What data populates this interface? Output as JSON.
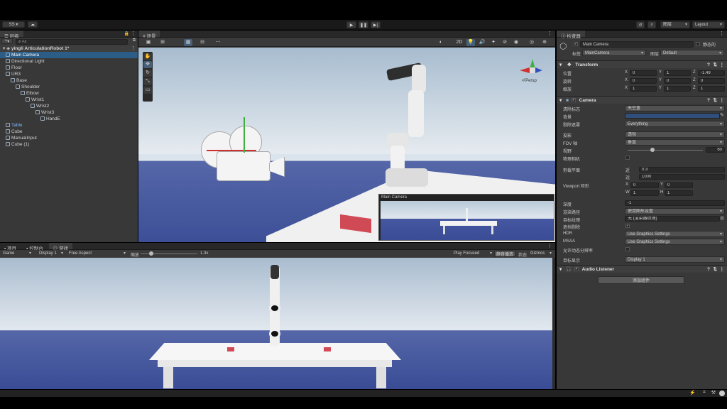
{
  "toolbar": {
    "account": "SS",
    "play_icon": "play-icon",
    "pause_icon": "pause-icon",
    "step_icon": "step-icon",
    "history_icon": "history-icon",
    "search_icon": "search-icon",
    "layers": "图层",
    "layout": "Layout"
  },
  "hierarchy": {
    "tab": "层级",
    "add": "+",
    "search_placeholder": "All",
    "scene": "yingli ArticulationRobot 1*",
    "items": [
      {
        "label": "Main Camera",
        "depth": 1,
        "selected": true
      },
      {
        "label": "Directional Light",
        "depth": 1
      },
      {
        "label": "Floor",
        "depth": 1
      },
      {
        "label": "UR3",
        "depth": 1
      },
      {
        "label": "Base",
        "depth": 2
      },
      {
        "label": "Shoulder",
        "depth": 3
      },
      {
        "label": "Elbow",
        "depth": 4
      },
      {
        "label": "Wrist1",
        "depth": 5
      },
      {
        "label": "Wrist2",
        "depth": 6
      },
      {
        "label": "Wrist3",
        "depth": 7
      },
      {
        "label": "HandE",
        "depth": 8
      },
      {
        "label": "Table",
        "depth": 1,
        "highlight": true
      },
      {
        "label": "Cube",
        "depth": 1
      },
      {
        "label": "ManualInput",
        "depth": 1
      },
      {
        "label": "Cube (1)",
        "depth": 1
      }
    ]
  },
  "scene": {
    "tab": "场景",
    "persp": "≮ Persp",
    "preview_title": "Main Camera"
  },
  "bottom": {
    "tabs": [
      "项目",
      "控制台",
      "游戏"
    ],
    "game": "Game",
    "display": "Display 1",
    "aspect": "Free Aspect",
    "scale_label": "缩放",
    "scale_value": "1.3x",
    "play_focused": "Play Focused",
    "mute": "静音播放",
    "stats": "状态",
    "gizmos": "Gizmos"
  },
  "inspector": {
    "tab": "检查器",
    "name": "Main Camera",
    "static": "静态的",
    "tag_label": "标签",
    "tag": "MainCamera",
    "layer_label": "图层",
    "layer": "Default",
    "transform": {
      "title": "Transform",
      "rows": [
        {
          "label": "位置",
          "x": "0",
          "y": "1",
          "z": "-1.49"
        },
        {
          "label": "旋转",
          "x": "0",
          "y": "0",
          "z": "0"
        },
        {
          "label": "缩放",
          "x": "1",
          "y": "1",
          "z": "1"
        }
      ]
    },
    "camera": {
      "title": "Camera",
      "clear_flags_label": "清除标志",
      "clear_flags": "天空盒",
      "background_label": "背景",
      "background_color": "#314d79",
      "culling_label": "剔除遮罩",
      "culling": "Everything",
      "projection_label": "投影",
      "projection": "透视",
      "fov_axis_label": "FOV 轴",
      "fov_axis": "垂直",
      "fov_label": "视野",
      "fov": "60",
      "fov_fraction": 0.33,
      "physical_label": "物理相机",
      "clip_label": "剪裁平面",
      "near_label": "近",
      "near": "0.3",
      "far_label": "远",
      "far": "1000",
      "viewport_label": "Viewport 矩形",
      "vx": "0",
      "vy": "0",
      "vw": "1",
      "vh": "1",
      "depth_label": "深度",
      "depth": "-1",
      "render_path_label": "渲染路径",
      "render_path": "使用图形设置",
      "target_tex_label": "目标纹理",
      "target_tex": "无 (渲染器纹理)",
      "occlusion_label": "遮挡剔除",
      "hdr_label": "HDR",
      "hdr": "Use Graphics Settings",
      "msaa_label": "MSAA",
      "msaa": "Use Graphics Settings",
      "dyn_res_label": "允许动态分辨率",
      "target_display_label": "目标显示",
      "target_display": "Display 1"
    },
    "audio": {
      "title": "Audio Listener"
    },
    "add_component": "添加组件"
  }
}
